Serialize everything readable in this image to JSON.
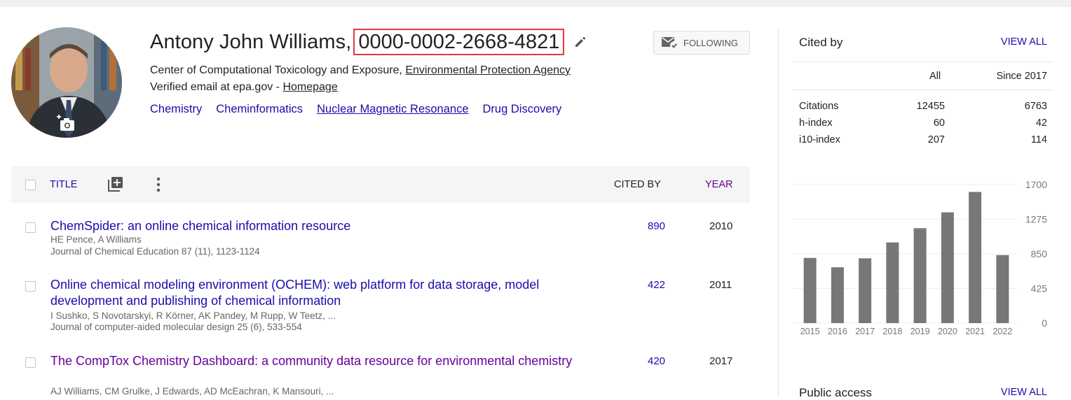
{
  "profile": {
    "name": "Antony John Williams,",
    "orcid": "0000-0002-2668-4821",
    "affiliation_prefix": "Center of Computational Toxicology and Exposure, ",
    "affiliation_link": "Environmental Protection Agency",
    "email_prefix": "Verified email at epa.gov - ",
    "email_link": "Homepage",
    "interests": [
      "Chemistry",
      "Cheminformatics",
      "Nuclear Magnetic Resonance",
      "Drug Discovery"
    ],
    "follow_label": "FOLLOWING"
  },
  "table": {
    "title_label": "TITLE",
    "cited_label": "CITED BY",
    "year_label": "YEAR"
  },
  "articles": [
    {
      "title": "ChemSpider: an online chemical information resource",
      "authors": "HE Pence, A Williams",
      "venue": "Journal of Chemical Education 87 (11), 1123-1124",
      "cited": "890",
      "year": "2010"
    },
    {
      "title": "Online chemical modeling environment (OCHEM): web platform for data storage, model development and publishing of chemical information",
      "authors": "I Sushko, S Novotarskyi, R Körner, AK Pandey, M Rupp, W Teetz, ...",
      "venue": "Journal of computer-aided molecular design 25 (6), 533-554",
      "cited": "422",
      "year": "2011"
    },
    {
      "title": "The CompTox Chemistry Dashboard: a community data resource for environmental chemistry",
      "authors": "AJ Williams, CM Grulke, J Edwards, AD McEachran, K Mansouri, ...",
      "venue": "",
      "cited": "420",
      "year": "2017"
    }
  ],
  "cited_by": {
    "title": "Cited by",
    "view_all": "VIEW ALL",
    "col_all": "All",
    "col_since": "Since 2017",
    "rows": [
      {
        "label": "Citations",
        "all": "12455",
        "since": "6763"
      },
      {
        "label": "h-index",
        "all": "60",
        "since": "42"
      },
      {
        "label": "i10-index",
        "all": "207",
        "since": "114"
      }
    ]
  },
  "chart_data": {
    "type": "bar",
    "categories": [
      "2015",
      "2016",
      "2017",
      "2018",
      "2019",
      "2020",
      "2021",
      "2022"
    ],
    "values": [
      800,
      685,
      795,
      990,
      1165,
      1360,
      1610,
      835
    ],
    "yticks": [
      "1700",
      "1275",
      "850",
      "425",
      "0"
    ],
    "ylim": [
      0,
      1700
    ],
    "bar_color": "#777777"
  },
  "public_access": {
    "title": "Public access",
    "view_all": "VIEW ALL"
  }
}
